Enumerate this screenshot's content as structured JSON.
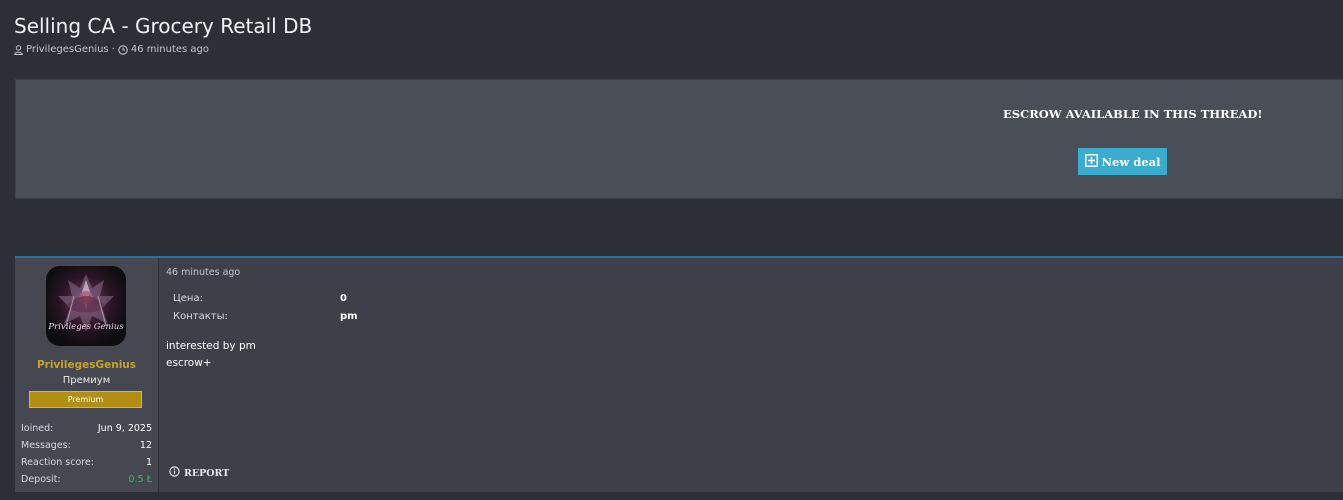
{
  "thread": {
    "title": "Selling CA - Grocery Retail DB",
    "author": "PrivilegesGenius",
    "separator": "·",
    "time": "46 minutes ago"
  },
  "escrow": {
    "notice": "ESCROW AVAILABLE IN THIS THREAD!",
    "button_label": "New deal",
    "button_color": "#3aaccf"
  },
  "post": {
    "user": {
      "name": "PrivilegesGenius",
      "avatar_text": "Privileges Genius",
      "title": "Премиум",
      "banner": "Premium",
      "name_color": "#c9a227",
      "banner_color": "#b38e14",
      "stats": [
        {
          "label": "Ioined:",
          "value": "Jun 9, 2025"
        },
        {
          "label": "Messages:",
          "value": "12"
        },
        {
          "label": "Reaction score:",
          "value": "1"
        },
        {
          "label": "Deposit:",
          "value": "0.5 Ł"
        }
      ]
    },
    "date": "46 minutes ago",
    "fields": [
      {
        "label": "Цена:",
        "value": "0"
      },
      {
        "label": "Контакты:",
        "value": "pm"
      }
    ],
    "body_lines": [
      "interested by pm",
      "escrow+"
    ],
    "report_label": "REPORT",
    "accent_color": "#2f6d9a"
  },
  "icons": {
    "author": "user-icon",
    "time": "clock-icon",
    "new_deal": "plus-square-icon",
    "report": "info-circle-icon"
  }
}
